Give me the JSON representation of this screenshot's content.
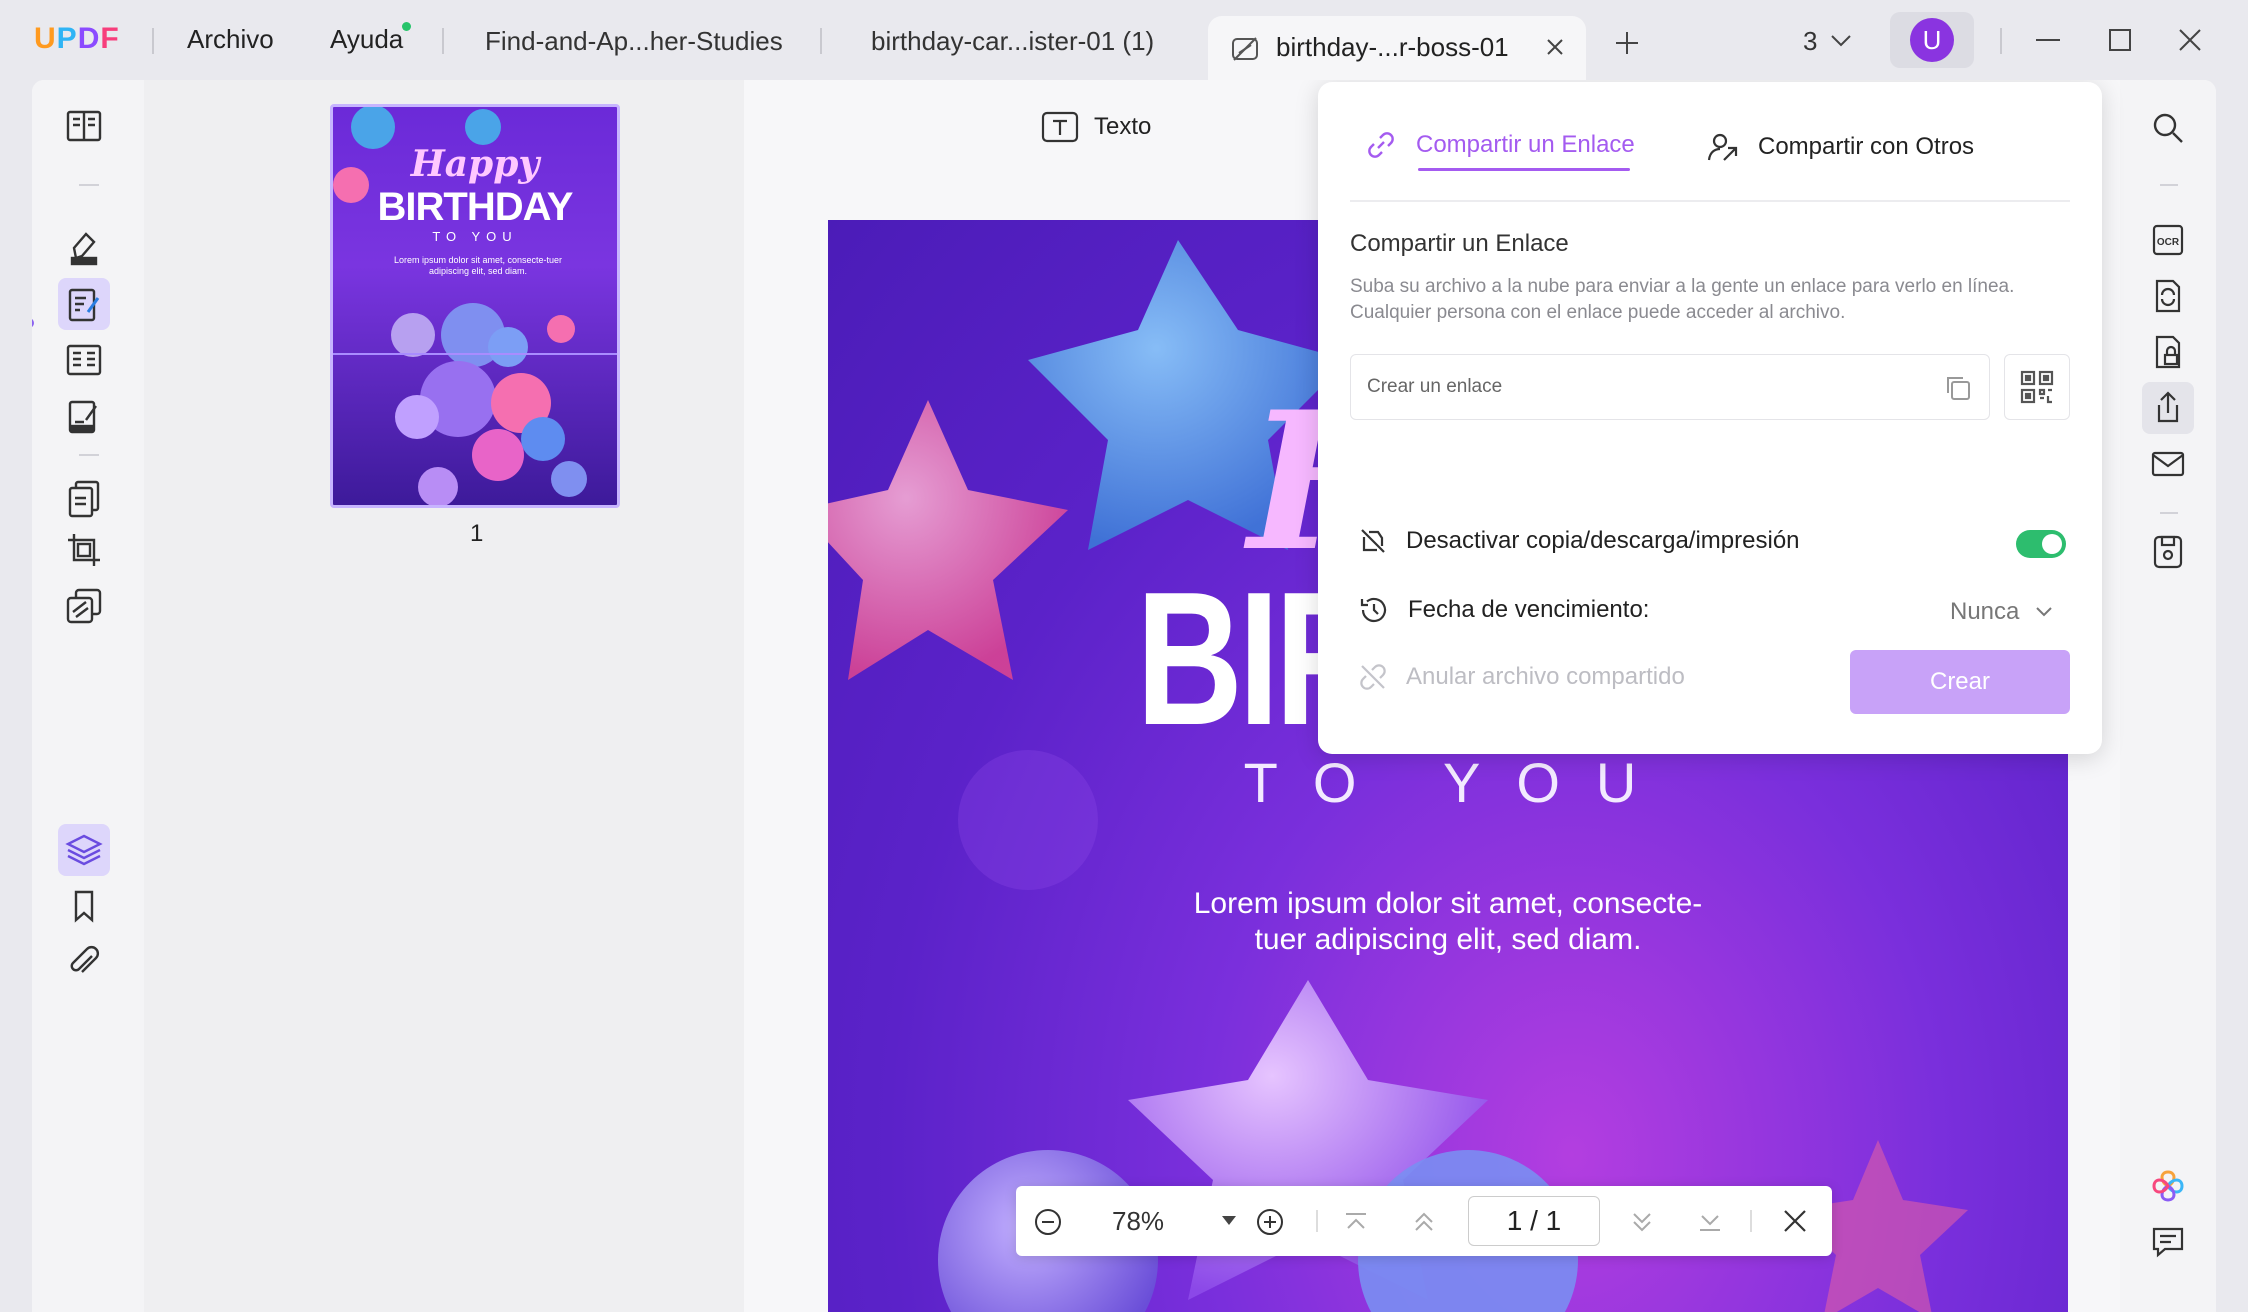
{
  "app": {
    "logo": [
      "U",
      "P",
      "D",
      "F"
    ],
    "menu": {
      "file": "Archivo",
      "help": "Ayuda"
    }
  },
  "tabs": [
    {
      "label": "Find-and-Ap...her-Studies"
    },
    {
      "label": "birthday-car...ister-01 (1)"
    },
    {
      "label": "birthday-...r-boss-01",
      "active": true
    }
  ],
  "window_count": "3",
  "user": {
    "initial": "U"
  },
  "thumbnail": {
    "page_number": "1",
    "happy": "Happy",
    "birthday": "BIRTHDAY",
    "to_you": "TO YOU",
    "lorem": "Lorem ipsum dolor sit amet, consecte-tuer adipiscing elit, sed diam."
  },
  "toolbar": {
    "text_tool": "Texto"
  },
  "document": {
    "happy": "Ha",
    "birth": "BIRT",
    "to_you": "TO YOU",
    "lorem_line1": "Lorem ipsum dolor sit amet, consecte-",
    "lorem_line2": "tuer adipiscing elit, sed diam."
  },
  "zoom": {
    "value": "78%",
    "page_current": "1",
    "page_sep": "/",
    "page_total": "1"
  },
  "share": {
    "tab_link": "Compartir un Enlace",
    "tab_others": "Compartir con Otros",
    "section_title": "Compartir un Enlace",
    "description_line1": "Suba su archivo a la nube para enviar a la gente un enlace para verlo en línea.",
    "description_line2": "Cualquier persona con el enlace puede acceder al archivo.",
    "link_placeholder": "Crear un enlace",
    "disable_copy_label": "Desactivar copia/descarga/impresión",
    "disable_copy_on": true,
    "expiry_label": "Fecha de vencimiento:",
    "expiry_value": "Nunca",
    "revoke_label": "Anular archivo compartido",
    "create_button": "Crear"
  },
  "colors": {
    "accent": "#a45bf0",
    "toggle_on": "#2dbd6e",
    "button": "#c8a2f8"
  }
}
